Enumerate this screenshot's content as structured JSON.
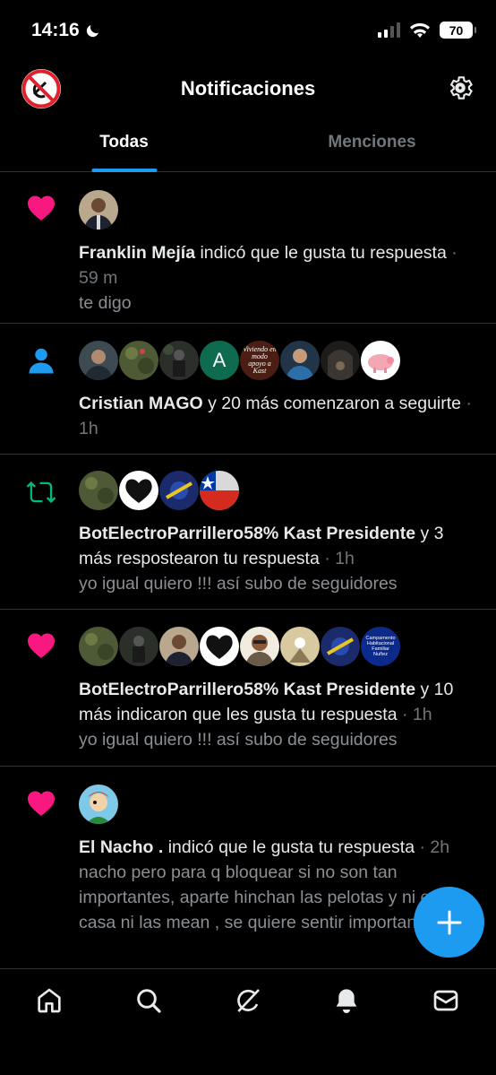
{
  "status_bar": {
    "time": "14:16",
    "battery": "70"
  },
  "header": {
    "title": "Notificaciones"
  },
  "tabs": [
    {
      "label": "Todas",
      "active": true
    },
    {
      "label": "Menciones",
      "active": false
    }
  ],
  "notifications": [
    {
      "type": "like",
      "actor": "Franklin Mejía",
      "action": " indicó que le gusta tu respuesta",
      "time": " · 59 m",
      "snippet": "te digo"
    },
    {
      "type": "follow",
      "actor": "Cristian MAGO",
      "action": " y 20 más comenzaron a seguirte",
      "time": " · 1h",
      "avatar_letter": "A",
      "avatar_text": "Viviendo en modo apoyo a Kast",
      "snippet": ""
    },
    {
      "type": "repost",
      "actor": "BotElectroParrillero58% Kast Presidente",
      "action": " y 3 más respostearon tu respuesta",
      "time": " · 1h",
      "snippet": "yo igual quiero !!! así subo de seguidores"
    },
    {
      "type": "like",
      "actor": "BotElectroParrillero58% Kast Presidente",
      "action": " y 10 más indicaron que les gusta tu respuesta",
      "time": " · 1h",
      "avatar_text": "Campamento Habitacional Familiar Nuñez",
      "snippet": "yo igual quiero !!! así subo de seguidores"
    },
    {
      "type": "like",
      "actor": "El Nacho .",
      "action": " indicó que le gusta tu respuesta",
      "time": " · 2h",
      "snippet": "nacho pero para q bloquear si no son tan importantes, aparte hinchan las pelotas y ni en su casa ni las mean , se quiere sentir importantes acá"
    }
  ],
  "colors": {
    "accent": "#1d9bf0",
    "like": "#f91880",
    "repost": "#00ba7c",
    "muted": "#71767b"
  },
  "bottom_nav": [
    "home-icon",
    "search-icon",
    "grok-icon",
    "bell-icon",
    "mail-icon"
  ]
}
